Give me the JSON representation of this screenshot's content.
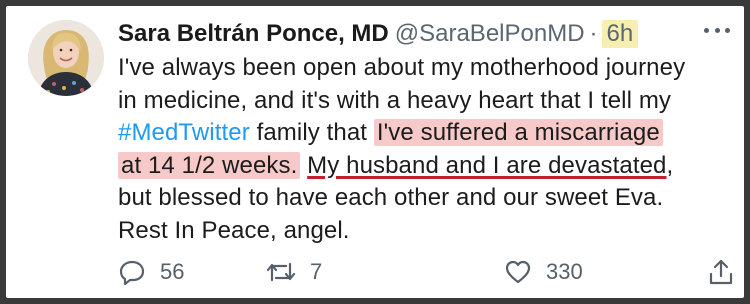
{
  "tweet": {
    "author_name": "Sara Beltrán Ponce, MD",
    "handle": "@SaraBelPonMD",
    "separator": "·",
    "time": "6h",
    "body": {
      "line1": "I've always been open about my motherhood journey",
      "line2": "in medicine, and it's with a heavy heart that I tell my",
      "line3_hashtag": "#MedTwitter",
      "line3_text": " family that ",
      "line3_highlight": "I've suffered a miscarriage",
      "line4_highlight": "at 14 1/2 weeks.",
      "line4_space": " ",
      "line4_underlined": "My husband and I are devastated",
      "line4_end": ",",
      "line5": "but blessed to have each other and our sweet Eva.",
      "line6": "Rest In Peace, angel."
    },
    "stats": {
      "replies": "56",
      "retweets": "7",
      "likes": "330"
    }
  },
  "annotations": {
    "highlight_color": "#f7c9c9",
    "underline_color": "#c0212b",
    "time_highlight_color": "#f6efb0"
  },
  "icons": {
    "reply": "reply-icon",
    "retweet": "retweet-icon",
    "like": "heart-icon",
    "share": "share-icon",
    "more": "more-options-icon"
  },
  "colors": {
    "hashtag": "#1d9bf0",
    "text": "#1c1c1c",
    "muted": "#5b6670"
  }
}
